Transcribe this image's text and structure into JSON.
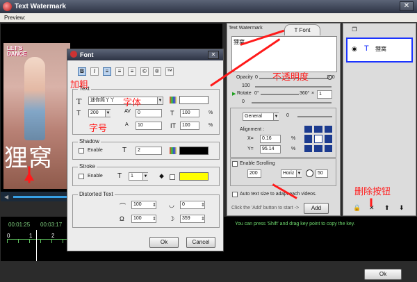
{
  "window": {
    "title": "Text Watermark",
    "close_glyph": "✕"
  },
  "menu": {
    "preview_label": "Preview:"
  },
  "video": {
    "logo_line1": "LET'S",
    "logo_line2": "DANCE",
    "watermark_text": "狸窝"
  },
  "timeline": {
    "time_left": "00:01:25",
    "time_right": "00:03:17",
    "hint": "You can press 'Shift' and drag key point to copy the key.",
    "ticks": [
      "0",
      "1",
      "2"
    ]
  },
  "footer": {
    "ok_label": "Ok"
  },
  "right_panel": {
    "tab_watermark": "Text Watermark",
    "tab_font": "Font",
    "text_value": "狸窝",
    "opacity_label": "Opacity",
    "opacity_min": "0",
    "opacity_max": "100",
    "opacity_value": "100",
    "rotate_label": "Rotate",
    "rotate_min": "0°",
    "rotate_max": "360°",
    "rotate_value": "0",
    "rotate_step": "1",
    "mode_value": "General",
    "mode_number": "0",
    "alignment_label": "Alignment :",
    "x_label": "X=",
    "x_value": "0.16",
    "y_label": "Y=",
    "y_value": "95.14",
    "percent": "%",
    "scrolling_label": "Enable Scrolling",
    "scroll_speed": "200",
    "scroll_dir": "Horiz",
    "scroll_value": "50",
    "autotext_label": "Auto text size to adapt each videos.",
    "click_hint": "Click the 'Add' button to start ->",
    "add_label": "Add"
  },
  "layers": {
    "item_label": "狸窝",
    "icons": [
      "lock",
      "delete",
      "up",
      "down"
    ]
  },
  "font_dialog": {
    "title": "Font",
    "close_glyph": "✕",
    "text_section": "Text",
    "font_name": "迷你简丫丫",
    "size": "200",
    "spacing": "0",
    "scale_w": "100",
    "line_gap": "10",
    "scale_h": "100",
    "percent": "%",
    "shadow_section": "Shadow",
    "shadow_enable": "Enable",
    "shadow_value": "2",
    "stroke_section": "Stroke",
    "stroke_enable": "Enable",
    "stroke_value": "1",
    "distorted_section": "Distorted Text",
    "dist_a": "100",
    "dist_b": "0",
    "dist_c": "100",
    "dist_d": "359",
    "ok_label": "Ok",
    "cancel_label": "Cancel",
    "colors": {
      "text": "#ffffff",
      "shadow": "#000000",
      "stroke": "#ffff00"
    }
  },
  "annotations": {
    "bold": "加粗",
    "font": "字体",
    "size": "字号",
    "opacity": "不透明度",
    "delete_btn": "删除按钮"
  }
}
